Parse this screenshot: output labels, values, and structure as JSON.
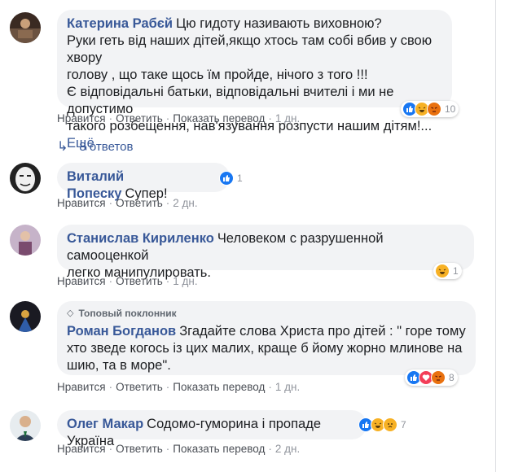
{
  "actions": {
    "like": "Нравится",
    "reply": "Ответить",
    "translate": "Показать перевод"
  },
  "comments": [
    {
      "name": "Катерина Рабєй",
      "lines": [
        "Цю гидоту називають виховною?",
        "Руки геть від наших дітей,якщо хтось там собі вбив у свою хвору",
        "голову , що таке щось їм пройде, нічого з того !!!",
        "Є відповідальні батьки, відповідальні вчителі і ми не допустимо",
        "такого розбещення, нав'язування розпусти нашим дітям!..."
      ],
      "more": "Ещё",
      "reactions": [
        "like-icon",
        "haha-icon",
        "angry-icon"
      ],
      "reaction_count": "10",
      "time": "1 дн."
    },
    {
      "name": "Виталий Попеску",
      "text": "Супер!",
      "reactions": [
        "like-icon"
      ],
      "reaction_count": "1",
      "time": "2 дн."
    },
    {
      "name": "Станислав Кириленко",
      "lines": [
        "Человеком с разрушенной самооценкой",
        "легко манипулировать."
      ],
      "reactions": [
        "haha-icon"
      ],
      "reaction_count": "1",
      "time": "1 дн."
    },
    {
      "badge": "Топовый поклонник",
      "name": "Роман Богданов",
      "lines": [
        "Згадайте слова Христа про дітей : \" горе тому",
        "хто зведе когось із цих малих, краще б йому жорно млинове на",
        "шию, та в море\"."
      ],
      "reactions": [
        "like-icon",
        "love-icon",
        "angry-icon"
      ],
      "reaction_count": "8",
      "time": "1 дн."
    },
    {
      "name": "Олег Макар",
      "text": "Содомо-гуморина і пропаде Україна",
      "reactions": [
        "like-icon",
        "haha-icon",
        "sad-icon"
      ],
      "reaction_count": "7",
      "time": "2 дн."
    }
  ],
  "replies_label": "8 ответов",
  "colors": {
    "name": "#385898",
    "bubble": "#f2f3f5",
    "meta": "#90949c",
    "like": "#1877f2",
    "love": "#f33e58",
    "angry": "#e9710f",
    "haha": "#f7b125"
  }
}
